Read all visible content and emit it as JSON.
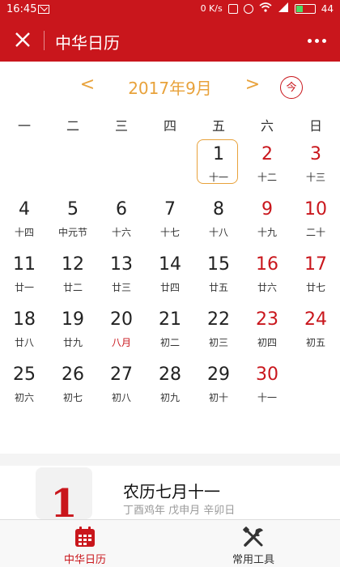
{
  "status_bar": {
    "time": "16:45",
    "net_speed": "0 K/s",
    "battery_level": "44",
    "battery_fraction": 0.44
  },
  "titlebar": {
    "title": "中华日历"
  },
  "calendar": {
    "month_label": "2017年9月",
    "prev_glyph": "<",
    "next_glyph": ">",
    "today_label": "今",
    "weekdays": [
      "一",
      "二",
      "三",
      "四",
      "五",
      "六",
      "日"
    ],
    "weeks": [
      [
        {
          "num": "",
          "lunar": ""
        },
        {
          "num": "",
          "lunar": ""
        },
        {
          "num": "",
          "lunar": ""
        },
        {
          "num": "",
          "lunar": ""
        },
        {
          "num": "1",
          "lunar": "十一",
          "selected": true
        },
        {
          "num": "2",
          "lunar": "十二",
          "weekend": true
        },
        {
          "num": "3",
          "lunar": "十三",
          "weekend": true
        }
      ],
      [
        {
          "num": "4",
          "lunar": "十四"
        },
        {
          "num": "5",
          "lunar": "中元节"
        },
        {
          "num": "6",
          "lunar": "十六"
        },
        {
          "num": "7",
          "lunar": "十七"
        },
        {
          "num": "8",
          "lunar": "十八"
        },
        {
          "num": "9",
          "lunar": "十九",
          "weekend": true
        },
        {
          "num": "10",
          "lunar": "二十",
          "weekend": true
        }
      ],
      [
        {
          "num": "11",
          "lunar": "廿一"
        },
        {
          "num": "12",
          "lunar": "廿二"
        },
        {
          "num": "13",
          "lunar": "廿三"
        },
        {
          "num": "14",
          "lunar": "廿四"
        },
        {
          "num": "15",
          "lunar": "廿五"
        },
        {
          "num": "16",
          "lunar": "廿六",
          "weekend": true
        },
        {
          "num": "17",
          "lunar": "廿七",
          "weekend": true
        }
      ],
      [
        {
          "num": "18",
          "lunar": "廿八"
        },
        {
          "num": "19",
          "lunar": "廿九"
        },
        {
          "num": "20",
          "lunar": "八月",
          "lunar_red": true
        },
        {
          "num": "21",
          "lunar": "初二"
        },
        {
          "num": "22",
          "lunar": "初三"
        },
        {
          "num": "23",
          "lunar": "初四",
          "weekend": true
        },
        {
          "num": "24",
          "lunar": "初五",
          "weekend": true
        }
      ],
      [
        {
          "num": "25",
          "lunar": "初六"
        },
        {
          "num": "26",
          "lunar": "初七"
        },
        {
          "num": "27",
          "lunar": "初八"
        },
        {
          "num": "28",
          "lunar": "初九"
        },
        {
          "num": "29",
          "lunar": "初十"
        },
        {
          "num": "30",
          "lunar": "十一",
          "weekend": true
        },
        {
          "num": "",
          "lunar": ""
        }
      ]
    ]
  },
  "detail": {
    "big_day": "1",
    "lunar_title": "农历七月十一",
    "ganzhi": "丁酉鸡年 戊申月 辛卯日"
  },
  "tabs": {
    "calendar_label": "中华日历",
    "tools_label": "常用工具"
  },
  "colors": {
    "brand_red": "#c9161c",
    "accent_orange": "#e8a23b"
  }
}
